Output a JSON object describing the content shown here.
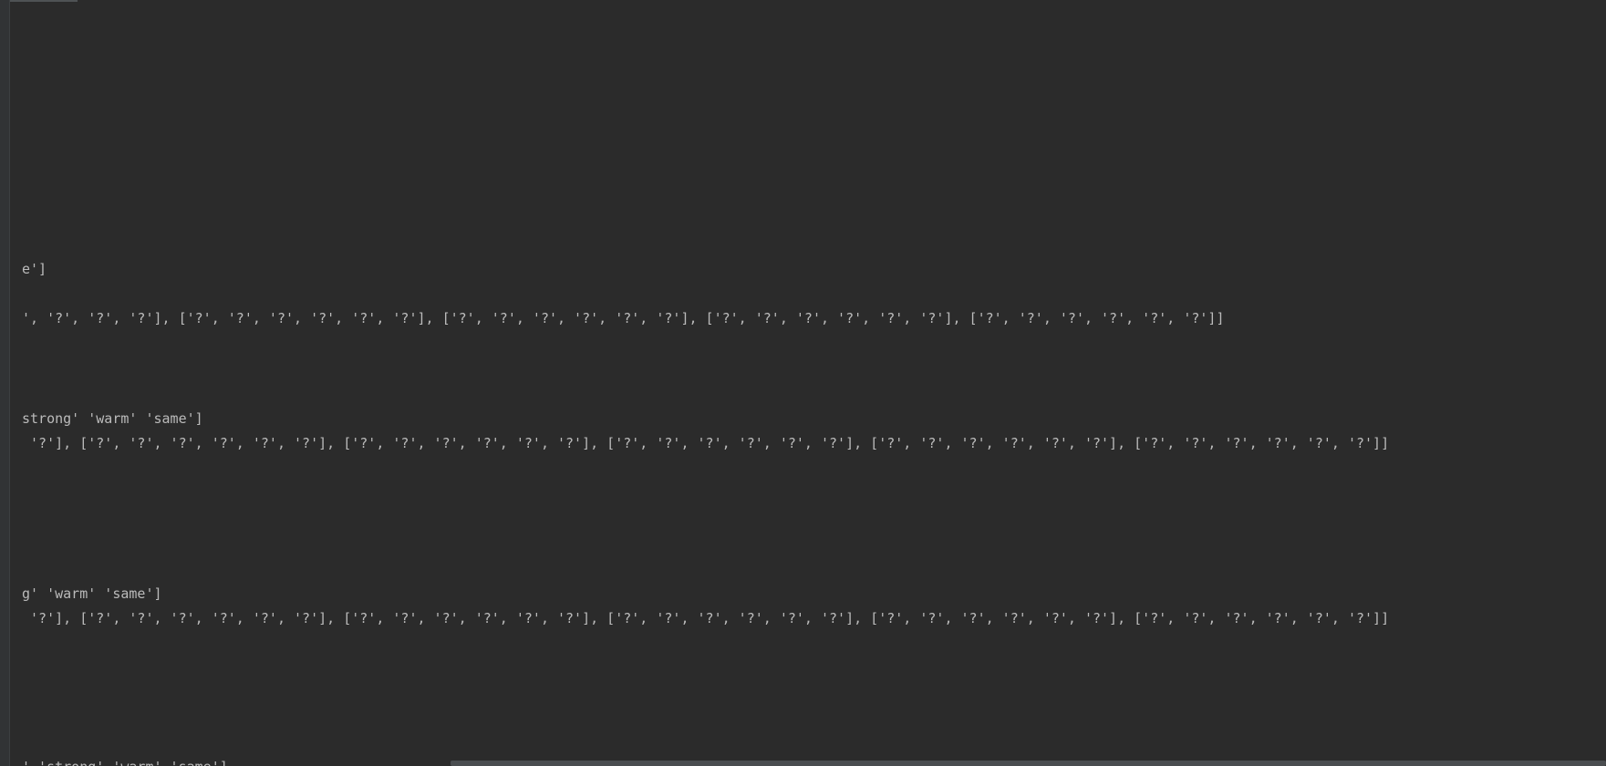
{
  "console": {
    "lines": [
      "e']",
      "', '?', '?', '?'], ['?', '?', '?', '?', '?', '?'], ['?', '?', '?', '?', '?', '?'], ['?', '?', '?', '?', '?', '?'], ['?', '?', '?', '?', '?', '?']]",
      "strong' 'warm' 'same']",
      " '?'], ['?', '?', '?', '?', '?', '?'], ['?', '?', '?', '?', '?', '?'], ['?', '?', '?', '?', '?', '?'], ['?', '?', '?', '?', '?', '?'], ['?', '?', '?', '?', '?', '?']]",
      "g' 'warm' 'same']",
      " '?'], ['?', '?', '?', '?', '?', '?'], ['?', '?', '?', '?', '?', '?'], ['?', '?', '?', '?', '?', '?'], ['?', '?', '?', '?', '?', '?'], ['?', '?', '?', '?', '?', '?']]",
      "' 'strong' 'warm' 'same']"
    ]
  },
  "colors": {
    "background": "#2b2b2b",
    "text": "#bbbbbb",
    "gutter": "#313335",
    "scrollbar_thumb": "#4a4d50"
  }
}
